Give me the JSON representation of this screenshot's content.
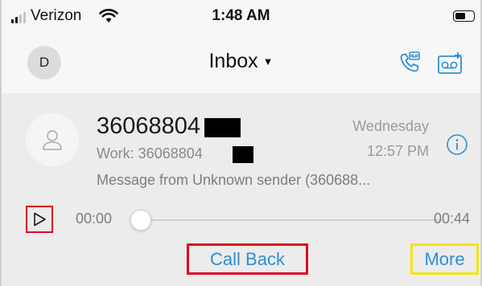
{
  "status_bar": {
    "carrier": "Verizon",
    "time": "1:48 AM",
    "battery_level": 0.6
  },
  "nav": {
    "user_initial": "D",
    "title": "Inbox"
  },
  "message": {
    "number": "36068804",
    "work_label": "Work: 36068804",
    "day": "Wednesday",
    "time": "12:57 PM",
    "preview": "Message from Unknown sender (360688...",
    "elapsed": "00:00",
    "duration": "00:44",
    "progress": 0.0
  },
  "actions": {
    "call_back": "Call Back",
    "more": "More"
  },
  "colors": {
    "accent": "#2d8fd5",
    "highlight_red": "#e0061f",
    "highlight_yellow": "#f5e514"
  },
  "icons": {
    "signal": "cellular-signal-icon",
    "wifi": "wifi-icon",
    "battery": "battery-icon",
    "title_caret": "caret-down-icon",
    "call": "phone-call-icon",
    "voicemail": "voicemail-add-icon",
    "contact": "person-icon",
    "info": "info-icon",
    "play": "play-icon"
  }
}
